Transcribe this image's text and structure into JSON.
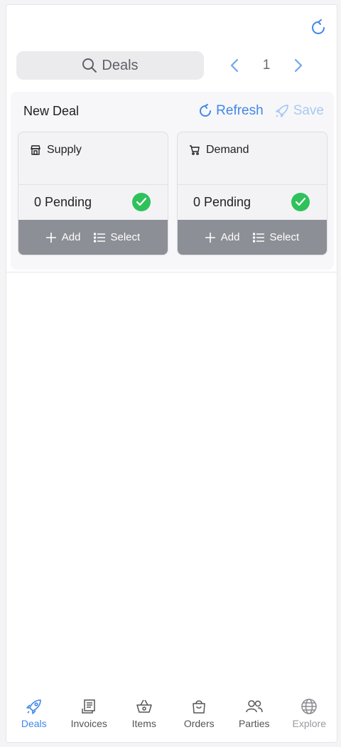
{
  "toolbar": {
    "refresh_icon": "refresh-icon"
  },
  "search": {
    "label": "Deals",
    "icon": "search-icon"
  },
  "pager": {
    "page": "1"
  },
  "deal": {
    "title": "New Deal",
    "refresh_label": "Refresh",
    "save_label": "Save",
    "cards": {
      "supply": {
        "title": "Supply",
        "pending": "0 Pending",
        "add": "Add",
        "select": "Select"
      },
      "demand": {
        "title": "Demand",
        "pending": "0 Pending",
        "add": "Add",
        "select": "Select"
      }
    }
  },
  "colors": {
    "accent": "#3f88e8",
    "accent_light": "#a9c8f2",
    "success": "#2fc25b",
    "action_bar": "#8d8f96"
  },
  "tabs": [
    {
      "label": "Deals",
      "icon": "rocket-icon",
      "state": "active"
    },
    {
      "label": "Invoices",
      "icon": "receipt-icon",
      "state": "normal"
    },
    {
      "label": "Items",
      "icon": "basket-icon",
      "state": "normal"
    },
    {
      "label": "Orders",
      "icon": "bag-icon",
      "state": "normal"
    },
    {
      "label": "Parties",
      "icon": "people-icon",
      "state": "normal"
    },
    {
      "label": "Explore",
      "icon": "globe-icon",
      "state": "muted"
    }
  ]
}
